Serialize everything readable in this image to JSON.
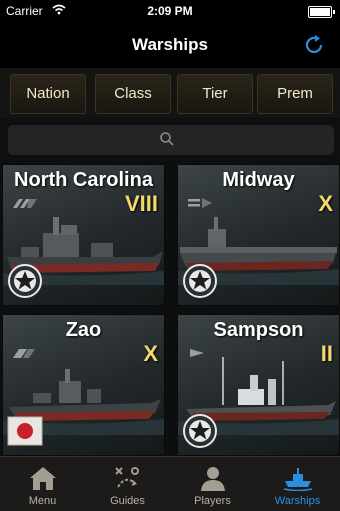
{
  "status_bar": {
    "carrier": "Carrier",
    "time": "2:09 PM"
  },
  "nav": {
    "title": "Warships",
    "refresh_icon": "refresh-icon"
  },
  "filters": [
    {
      "label": "Nation"
    },
    {
      "label": "Class"
    },
    {
      "label": "Tier"
    },
    {
      "label": "Prem"
    }
  ],
  "search": {
    "placeholder": "",
    "icon": "search-icon"
  },
  "ships": [
    {
      "name": "North Carolina",
      "tier": "VIII",
      "type": "battleship",
      "nation": "usa"
    },
    {
      "name": "Midway",
      "tier": "X",
      "type": "aircraft-carrier",
      "nation": "usa"
    },
    {
      "name": "Zao",
      "tier": "X",
      "type": "cruiser",
      "nation": "japan"
    },
    {
      "name": "Sampson",
      "tier": "II",
      "type": "destroyer",
      "nation": "usa"
    }
  ],
  "tabs": [
    {
      "label": "Menu",
      "icon": "home-icon"
    },
    {
      "label": "Guides",
      "icon": "tactics-icon"
    },
    {
      "label": "Players",
      "icon": "person-icon"
    },
    {
      "label": "Warships",
      "icon": "warship-icon",
      "active": true
    }
  ],
  "colors": {
    "accent": "#2b8fe0",
    "tier": "#f3d86b",
    "filter_text": "#f1e9c8"
  }
}
